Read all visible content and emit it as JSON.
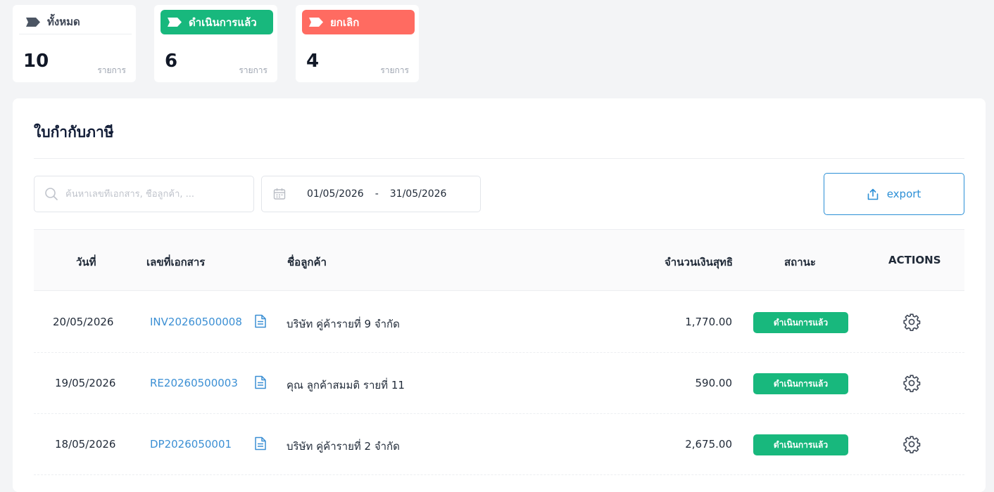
{
  "summary": {
    "all": {
      "label": "ทั้งหมด",
      "count": "10",
      "unit": "รายการ"
    },
    "done": {
      "label": "ดำเนินการแล้ว",
      "count": "6",
      "unit": "รายการ"
    },
    "cancelled": {
      "label": "ยกเลิก",
      "count": "4",
      "unit": "รายการ"
    }
  },
  "page": {
    "title": "ใบกำกับภาษี"
  },
  "filters": {
    "search_placeholder": "ค้นหาเลขที่เอกสาร, ชื่อลูกค้า, ...",
    "date_from": "01/05/2026",
    "date_sep": "-",
    "date_to": "31/05/2026",
    "export_label": "export"
  },
  "table": {
    "headers": {
      "date": "วันที่",
      "doc_no": "เลขที่เอกสาร",
      "customer": "ชื่อลูกค้า",
      "net_amount": "จำนวนเงินสุทธิ",
      "status": "สถานะ",
      "actions": "ACTIONS"
    },
    "rows": [
      {
        "date": "20/05/2026",
        "doc_no": "INV20260500008",
        "customer": "บริษัท คู่ค้ารายที่ 9 จำกัด",
        "amount": "1,770.00",
        "status": "ดำเนินการแล้ว"
      },
      {
        "date": "19/05/2026",
        "doc_no": "RE20260500003",
        "customer": "คุณ ลูกค้าสมมติ รายที่ 11",
        "amount": "590.00",
        "status": "ดำเนินการแล้ว"
      },
      {
        "date": "18/05/2026",
        "doc_no": "DP2026050001",
        "customer": "บริษัท คู่ค้ารายที่ 2 จำกัด",
        "amount": "2,675.00",
        "status": "ดำเนินการแล้ว"
      }
    ]
  },
  "colors": {
    "accent": "#2b8fd6",
    "success": "#18b87d",
    "danger": "#ff6b61",
    "neutral": "#4b5563"
  },
  "icons": {
    "tag": "tag-icon",
    "search": "search-icon",
    "calendar": "calendar-icon",
    "export": "upload-icon",
    "document": "document-icon",
    "settings": "gear-icon"
  }
}
